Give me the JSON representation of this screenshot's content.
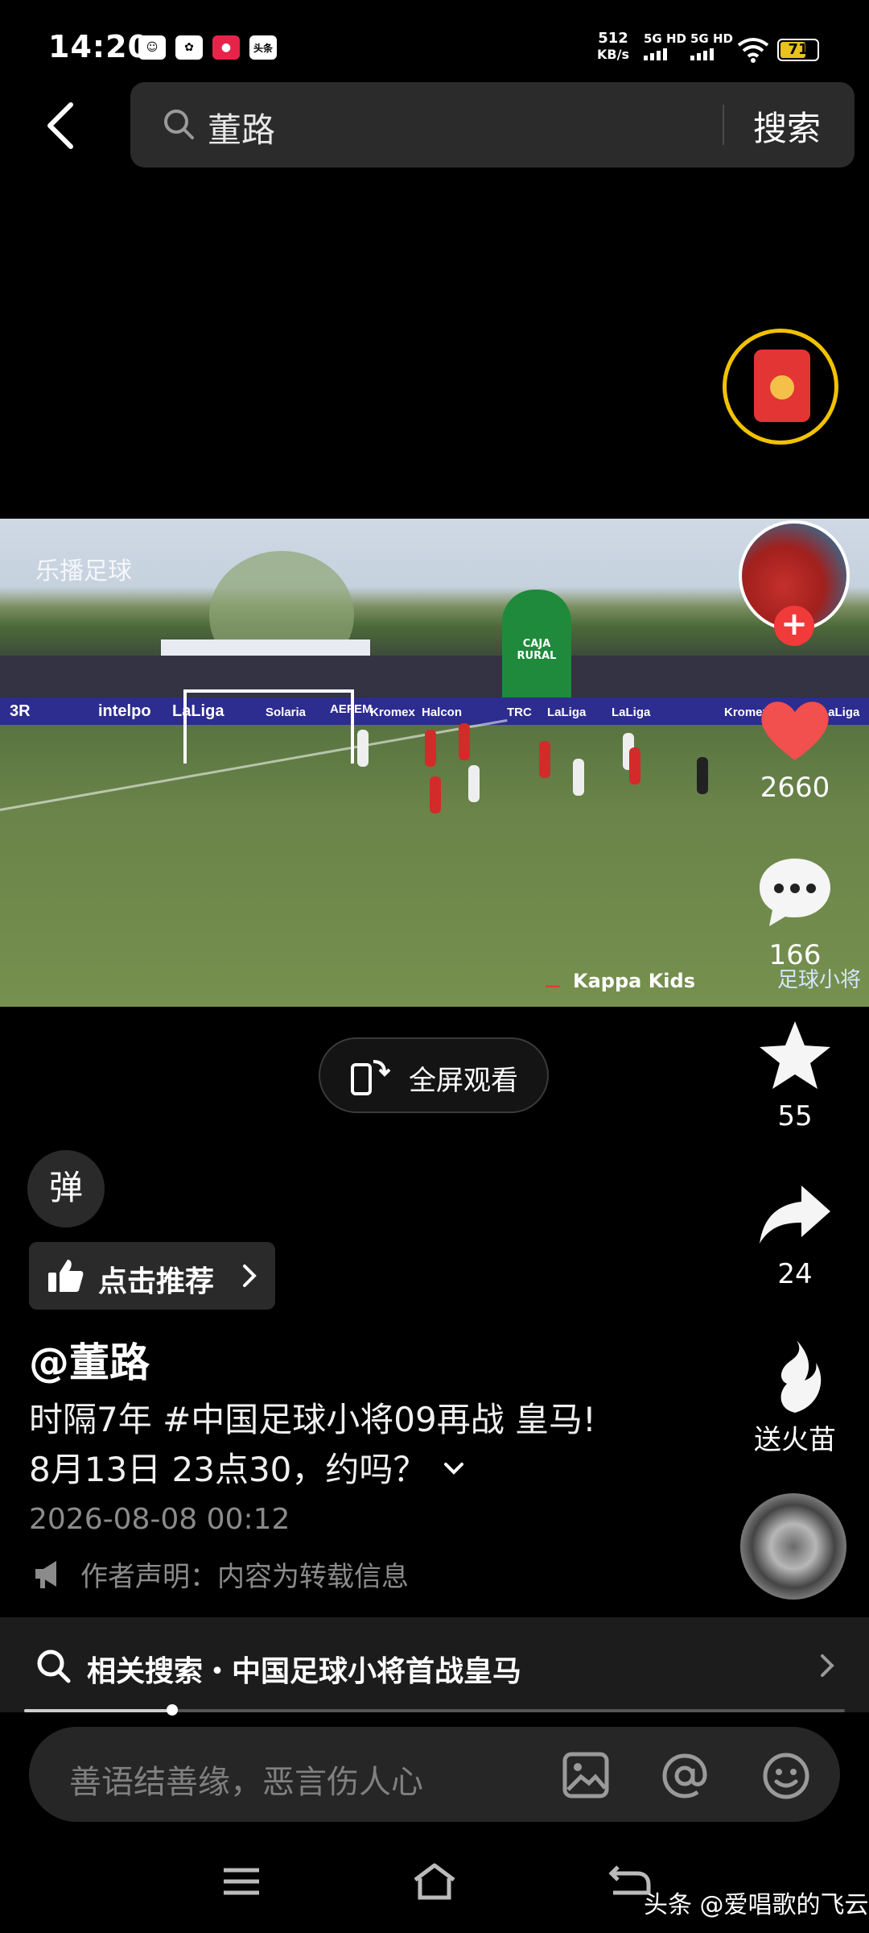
{
  "status_bar": {
    "time": "14:20",
    "app_icons": [
      "头条"
    ],
    "net_speed_value": "512",
    "net_speed_unit": "KB/s",
    "sim1": "5G HD",
    "sim2": "5G HD",
    "battery": "71",
    "battery_level": 0.71
  },
  "search": {
    "query": "董路",
    "button_label": "搜索"
  },
  "video": {
    "watermark_left": "乐播足球",
    "ad_texts": [
      "3R",
      "intelpo",
      "LaLiga",
      "Solaria",
      "AEFEM",
      "Kromex",
      "Halcon",
      "TRC",
      "LaLiga",
      "LaLiga",
      "Kromex",
      "LaLiga"
    ],
    "tower_text": "CAJA RURAL",
    "sponsor": "Kappa Kids",
    "watermark_right": "足球小将"
  },
  "actions": {
    "likes": "2660",
    "comments": "166",
    "favorites": "55",
    "shares": "24",
    "fire_label": "送火苗"
  },
  "fullscreen_label": "全屏观看",
  "danmu_label": "弹",
  "recommend_label": "点击推荐",
  "post": {
    "author": "@董路",
    "description_line1": "时隔7年 #中国足球小将09再战 皇马!",
    "description_line2": "8月13日 23点30，约吗？",
    "date": "2026-08-08 00:12",
    "declaration": "作者声明：内容为转载信息"
  },
  "related_search": "相关搜索・中国足球小将首战皇马",
  "progress": 0.18,
  "comment_placeholder": "善语结善缘，恶言伤人心",
  "watermark": "头条 @爱唱歌的飞云"
}
